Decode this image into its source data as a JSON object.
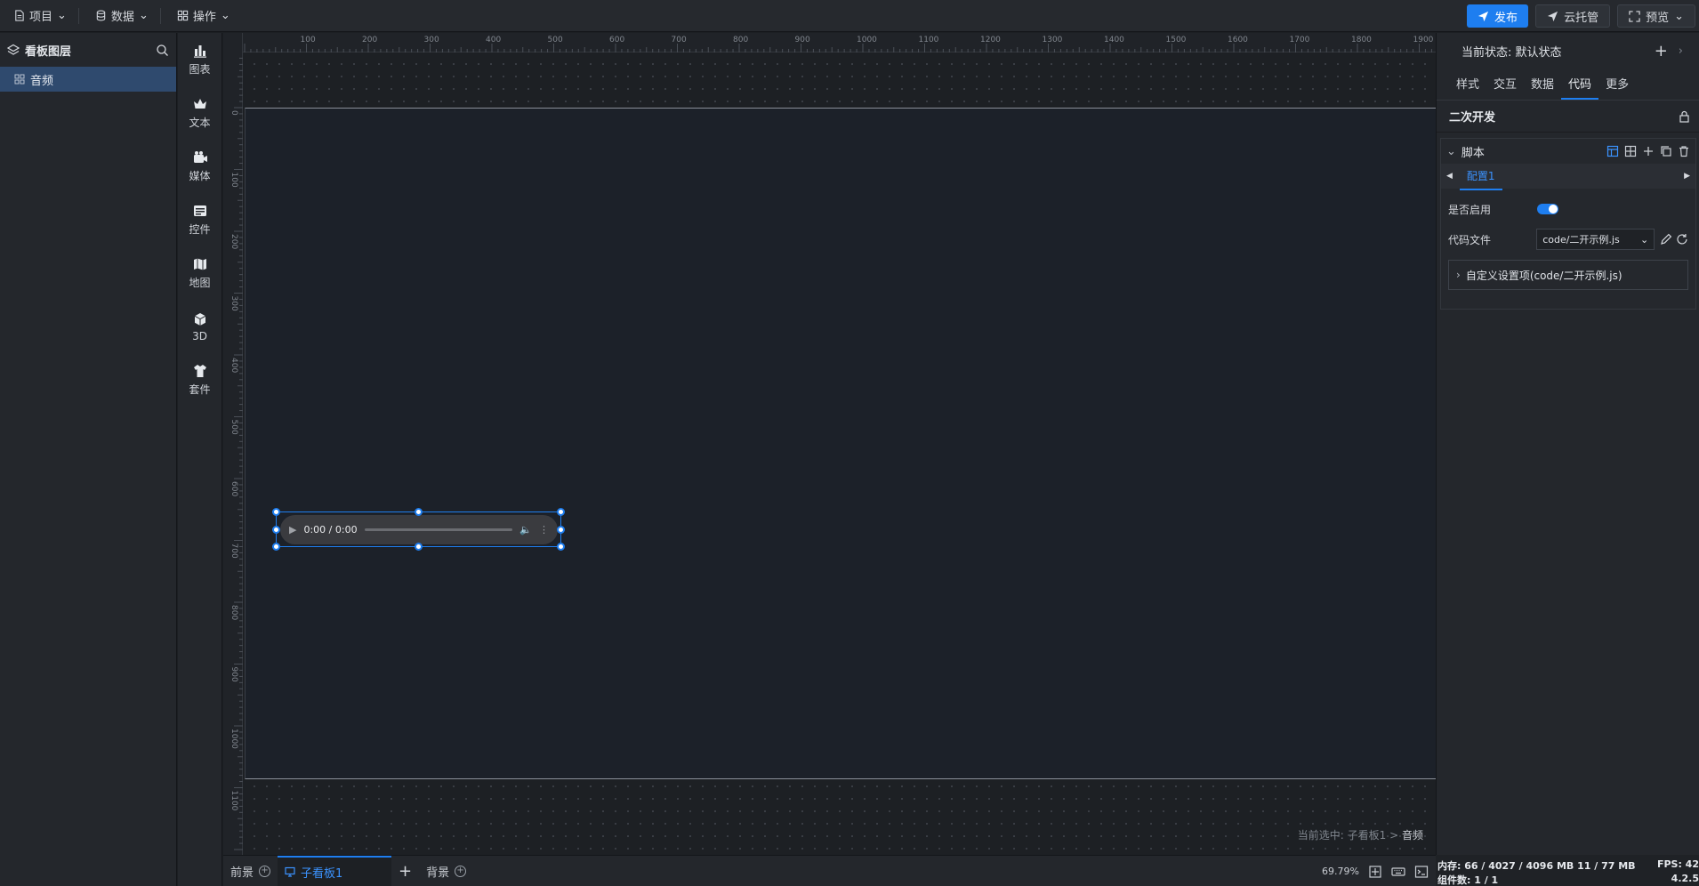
{
  "menu": [
    {
      "label": "项目",
      "icon": "document-icon"
    },
    {
      "label": "数据",
      "icon": "database-icon"
    },
    {
      "label": "操作",
      "icon": "grid-icon"
    }
  ],
  "actions": {
    "publish": "发布",
    "hosting": "云托管",
    "preview": "预览"
  },
  "layers": {
    "title": "看板图层",
    "items": [
      {
        "label": "音频"
      }
    ]
  },
  "tools": [
    {
      "label": "图表",
      "icon": "bar-chart-icon"
    },
    {
      "label": "文本",
      "icon": "crown-icon"
    },
    {
      "label": "媒体",
      "icon": "camera-icon"
    },
    {
      "label": "控件",
      "icon": "widget-icon"
    },
    {
      "label": "地图",
      "icon": "map-icon"
    },
    {
      "label": "3D",
      "icon": "cube-icon"
    },
    {
      "label": "套件",
      "icon": "shirt-icon"
    }
  ],
  "ruler": {
    "h_labels": [
      "100",
      "200",
      "300",
      "400",
      "500",
      "600",
      "700",
      "800",
      "900",
      "1000",
      "1100",
      "1200",
      "1300",
      "1400",
      "1500",
      "1600",
      "1700",
      "1800",
      "1900"
    ],
    "v_labels": [
      "0",
      "100",
      "200",
      "300",
      "400",
      "500",
      "600",
      "700",
      "800",
      "900",
      "1000",
      "1100"
    ]
  },
  "audio": {
    "time": "0:00 / 0:00"
  },
  "canvas": {
    "crumb_prefix": "当前选中:",
    "crumb_path": "子看板1 >",
    "crumb_item": "音频"
  },
  "bottom_tabs": {
    "foreground": "前景",
    "sub_board": "子看板1",
    "background": "背景"
  },
  "zoom": "69.79%",
  "right_panel": {
    "state": "当前状态: 默认状态",
    "tabs": [
      "样式",
      "交互",
      "数据",
      "代码",
      "更多"
    ],
    "active_tab": "代码",
    "section": "二次开发",
    "script_title": "脚本",
    "config_tab": "配置1",
    "enable_label": "是否启用",
    "enabled": true,
    "code_file_label": "代码文件",
    "code_file_value": "code/二开示例.js",
    "custom_settings": "自定义设置项(code/二开示例.js)"
  },
  "status": {
    "memory": "内存:  66 / 4027 / 4096 MB  11 / 77 MB",
    "fps": "FPS:  42",
    "components": "组件数: 1 / 1",
    "version": "4.2.5"
  },
  "colors": {
    "accent": "#1e7ef0",
    "canvas_bg": "#1c2129",
    "panel_bg": "#24272c"
  }
}
